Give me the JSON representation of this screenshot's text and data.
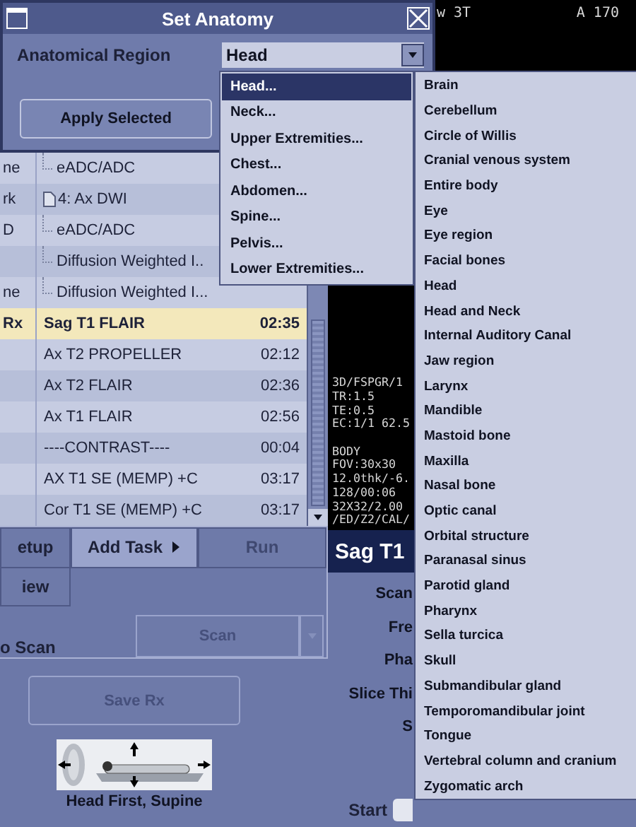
{
  "dialog": {
    "title": "Set Anatomy",
    "region_label": "Anatomical Region",
    "region_value": "Head",
    "apply_button": "Apply Selected"
  },
  "region_menu": [
    {
      "label": "Head...",
      "selected": true
    },
    {
      "label": "Neck...",
      "selected": false
    },
    {
      "label": "Upper Extremities...",
      "selected": false
    },
    {
      "label": "Chest...",
      "selected": false
    },
    {
      "label": "Abdomen...",
      "selected": false
    },
    {
      "label": "Spine...",
      "selected": false
    },
    {
      "label": "Pelvis...",
      "selected": false
    },
    {
      "label": "Lower Extremities...",
      "selected": false
    }
  ],
  "anatomy_list": [
    "Brain",
    "Cerebellum",
    "Circle of Willis",
    "Cranial venous system",
    "Entire body",
    "Eye",
    "Eye region",
    "Facial bones",
    "Head",
    "Head and Neck",
    "Internal Auditory Canal",
    "Jaw region",
    "Larynx",
    "Mandible",
    "Mastoid bone",
    "Maxilla",
    "Nasal bone",
    "Optic canal",
    "Orbital structure",
    "Paranasal sinus",
    "Parotid gland",
    "Pharynx",
    "Sella turcica",
    "Skull",
    "Submandibular gland",
    "Temporomandibular joint",
    "Tongue",
    "Vertebral column and cranium",
    "Zygomatic arch"
  ],
  "protocol_rows": [
    {
      "kind": "child",
      "status": "ne",
      "name": "eADC/ADC",
      "selected": false
    },
    {
      "kind": "series",
      "status": "rk",
      "name": "4: Ax DWI",
      "selected": false
    },
    {
      "kind": "child",
      "status": "D",
      "name": "eADC/ADC",
      "selected": false
    },
    {
      "kind": "child",
      "name": "Diffusion Weighted I..",
      "selected": false
    },
    {
      "kind": "child",
      "status": "ne",
      "name": "Diffusion Weighted I...",
      "selected": false
    },
    {
      "kind": "protocol",
      "status": "Rx",
      "name": "Sag T1 FLAIR",
      "time": "02:35",
      "selected": true
    },
    {
      "kind": "protocol",
      "name": "Ax T2 PROPELLER",
      "time": "02:12",
      "selected": false
    },
    {
      "kind": "protocol",
      "name": "Ax T2 FLAIR",
      "time": "02:36",
      "selected": false
    },
    {
      "kind": "protocol",
      "name": "Ax T1 FLAIR",
      "time": "02:56",
      "selected": false
    },
    {
      "kind": "protocol",
      "name": "----CONTRAST----",
      "time": "00:04",
      "selected": false
    },
    {
      "kind": "protocol",
      "name": "AX T1 SE (MEMP) +C",
      "time": "03:17",
      "selected": false
    },
    {
      "kind": "protocol",
      "name": "Cor T1 SE (MEMP) +C",
      "time": "03:17",
      "selected": false
    }
  ],
  "image_overlay": {
    "top_left": "w 3T",
    "top_right": "A 170",
    "info_blocks": [
      [
        "3D/FSPGR/1",
        "TR:1.5",
        "TE:0.5",
        "EC:1/1 62.5"
      ],
      [
        "BODY",
        "FOV:30x30",
        "12.0thk/-6.",
        "128/00:06",
        "32X32/2.00",
        "/ED/Z2/CAL/"
      ]
    ]
  },
  "task_tabs": [
    {
      "label": "etup",
      "selected": false,
      "disabled": false
    },
    {
      "label": "Add Task",
      "selected": true,
      "disabled": false
    },
    {
      "label": "Run",
      "selected": false,
      "disabled": true
    }
  ],
  "view_button": "iew",
  "scan_label": "o Scan",
  "scan_button": {
    "label": "Scan",
    "disabled": true
  },
  "save_button": {
    "label": "Save Rx",
    "disabled": true
  },
  "patient_position": "Head First, Supine",
  "rx_panel": {
    "title": "Sag T1",
    "labels": [
      "Scan",
      "Fre",
      "Pha",
      "Slice Thi",
      "S"
    ],
    "start_label": "Start"
  }
}
